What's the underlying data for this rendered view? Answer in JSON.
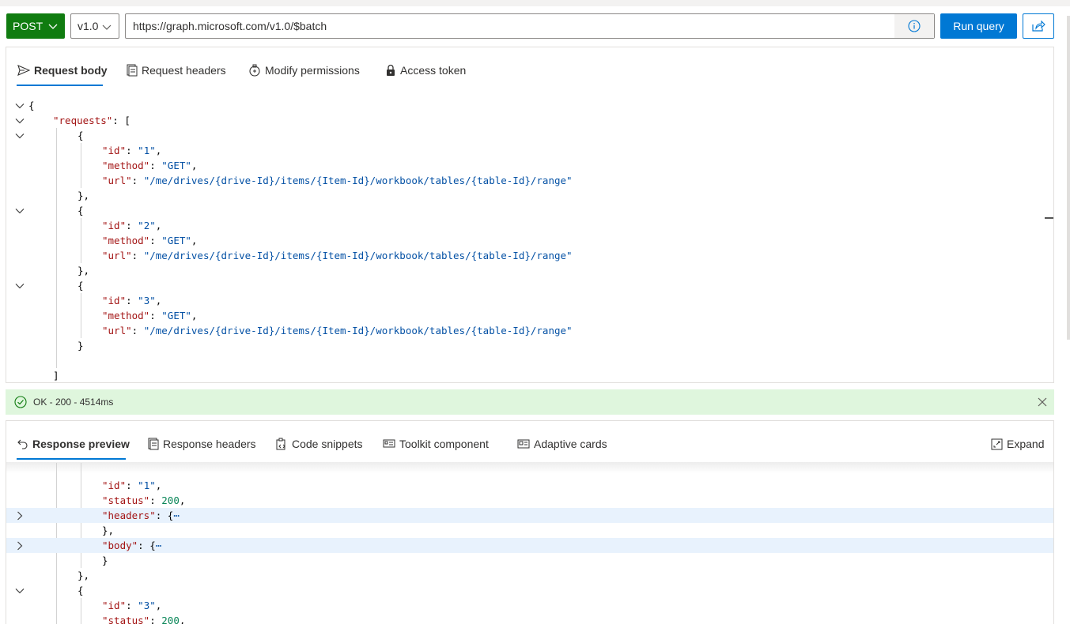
{
  "query": {
    "method": "POST",
    "version": "v1.0",
    "url": "https://graph.microsoft.com/v1.0/$batch",
    "run_label": "Run query"
  },
  "request_tabs": [
    {
      "label": "Request body",
      "icon": "send-icon"
    },
    {
      "label": "Request headers",
      "icon": "document-icon"
    },
    {
      "label": "Modify permissions",
      "icon": "permissions-icon"
    },
    {
      "label": "Access token",
      "icon": "lock-icon"
    }
  ],
  "request_body": [
    {
      "fold": true,
      "indent": 0,
      "parts": [
        [
          "p",
          "{"
        ]
      ]
    },
    {
      "fold": true,
      "indent": 1,
      "parts": [
        [
          "k",
          "\"requests\""
        ],
        [
          "p",
          ": ["
        ]
      ]
    },
    {
      "fold": true,
      "indent": 2,
      "parts": [
        [
          "p",
          "{"
        ]
      ]
    },
    {
      "fold": false,
      "indent": 3,
      "parts": [
        [
          "k",
          "\"id\""
        ],
        [
          "p",
          ": "
        ],
        [
          "s",
          "\"1\""
        ],
        [
          "p",
          ","
        ]
      ]
    },
    {
      "fold": false,
      "indent": 3,
      "parts": [
        [
          "k",
          "\"method\""
        ],
        [
          "p",
          ": "
        ],
        [
          "s",
          "\"GET\""
        ],
        [
          "p",
          ","
        ]
      ]
    },
    {
      "fold": false,
      "indent": 3,
      "parts": [
        [
          "k",
          "\"url\""
        ],
        [
          "p",
          ": "
        ],
        [
          "s",
          "\"/me/drives/{drive-Id}/items/{Item-Id}/workbook/tables/{table-Id}/range\""
        ]
      ]
    },
    {
      "fold": false,
      "indent": 2,
      "parts": [
        [
          "p",
          "},"
        ]
      ]
    },
    {
      "fold": true,
      "indent": 2,
      "parts": [
        [
          "p",
          "{"
        ]
      ]
    },
    {
      "fold": false,
      "indent": 3,
      "parts": [
        [
          "k",
          "\"id\""
        ],
        [
          "p",
          ": "
        ],
        [
          "s",
          "\"2\""
        ],
        [
          "p",
          ","
        ]
      ]
    },
    {
      "fold": false,
      "indent": 3,
      "parts": [
        [
          "k",
          "\"method\""
        ],
        [
          "p",
          ": "
        ],
        [
          "s",
          "\"GET\""
        ],
        [
          "p",
          ","
        ]
      ]
    },
    {
      "fold": false,
      "indent": 3,
      "parts": [
        [
          "k",
          "\"url\""
        ],
        [
          "p",
          ": "
        ],
        [
          "s",
          "\"/me/drives/{drive-Id}/items/{Item-Id}/workbook/tables/{table-Id}/range\""
        ]
      ]
    },
    {
      "fold": false,
      "indent": 2,
      "parts": [
        [
          "p",
          "},"
        ]
      ]
    },
    {
      "fold": true,
      "indent": 2,
      "parts": [
        [
          "p",
          "{"
        ]
      ]
    },
    {
      "fold": false,
      "indent": 3,
      "parts": [
        [
          "k",
          "\"id\""
        ],
        [
          "p",
          ": "
        ],
        [
          "s",
          "\"3\""
        ],
        [
          "p",
          ","
        ]
      ]
    },
    {
      "fold": false,
      "indent": 3,
      "parts": [
        [
          "k",
          "\"method\""
        ],
        [
          "p",
          ": "
        ],
        [
          "s",
          "\"GET\""
        ],
        [
          "p",
          ","
        ]
      ]
    },
    {
      "fold": false,
      "indent": 3,
      "parts": [
        [
          "k",
          "\"url\""
        ],
        [
          "p",
          ": "
        ],
        [
          "s",
          "\"/me/drives/{drive-Id}/items/{Item-Id}/workbook/tables/{table-Id}/range\""
        ]
      ]
    },
    {
      "fold": false,
      "indent": 2,
      "parts": [
        [
          "p",
          "}"
        ]
      ]
    },
    {
      "fold": false,
      "indent": 2,
      "parts": []
    },
    {
      "fold": false,
      "indent": 1,
      "parts": [
        [
          "p",
          "]"
        ]
      ]
    }
  ],
  "status": {
    "text": "OK - 200 - 4514ms",
    "color": "#dff6dd"
  },
  "response_tabs": [
    {
      "label": "Response preview",
      "icon": "undo-arrow-icon"
    },
    {
      "label": "Response headers",
      "icon": "document-icon"
    },
    {
      "label": "Code snippets",
      "icon": "code-icon"
    },
    {
      "label": "Toolkit component",
      "icon": "component-icon"
    },
    {
      "label": "Adaptive cards",
      "icon": "card-icon"
    }
  ],
  "expand_label": "Expand",
  "response_body": [
    {
      "fold": "none",
      "hl": false,
      "indent": 3,
      "parts": [
        [
          "k",
          "\"id\""
        ],
        [
          "p",
          ": "
        ],
        [
          "s",
          "\"1\""
        ],
        [
          "p",
          ","
        ]
      ]
    },
    {
      "fold": "none",
      "hl": false,
      "indent": 3,
      "parts": [
        [
          "k",
          "\"status\""
        ],
        [
          "p",
          ": "
        ],
        [
          "n",
          "200"
        ],
        [
          "p",
          ","
        ]
      ]
    },
    {
      "fold": "closed",
      "hl": true,
      "indent": 3,
      "parts": [
        [
          "k",
          "\"headers\""
        ],
        [
          "p",
          ": {"
        ],
        [
          "s",
          "⋯"
        ]
      ]
    },
    {
      "fold": "none",
      "hl": false,
      "indent": 3,
      "parts": [
        [
          "p",
          "},"
        ]
      ]
    },
    {
      "fold": "closed",
      "hl": true,
      "indent": 3,
      "parts": [
        [
          "k",
          "\"body\""
        ],
        [
          "p",
          ": {"
        ],
        [
          "s",
          "⋯"
        ]
      ]
    },
    {
      "fold": "none",
      "hl": false,
      "indent": 3,
      "parts": [
        [
          "p",
          "}"
        ]
      ]
    },
    {
      "fold": "none",
      "hl": false,
      "indent": 2,
      "parts": [
        [
          "p",
          "},"
        ]
      ]
    },
    {
      "fold": "open",
      "hl": false,
      "indent": 2,
      "parts": [
        [
          "p",
          "{"
        ]
      ]
    },
    {
      "fold": "none",
      "hl": false,
      "indent": 3,
      "parts": [
        [
          "k",
          "\"id\""
        ],
        [
          "p",
          ": "
        ],
        [
          "s",
          "\"3\""
        ],
        [
          "p",
          ","
        ]
      ]
    },
    {
      "fold": "none",
      "hl": false,
      "indent": 3,
      "parts": [
        [
          "k",
          "\"status\""
        ],
        [
          "p",
          ": "
        ],
        [
          "n",
          "200"
        ],
        [
          "p",
          ","
        ]
      ]
    }
  ],
  "colors": {
    "method_green": "#107c10",
    "run_blue": "#0078d4",
    "json_key": "#a31515",
    "json_string": "#0451a5",
    "json_number": "#098658",
    "line_highlight": "#e8f2fd"
  }
}
